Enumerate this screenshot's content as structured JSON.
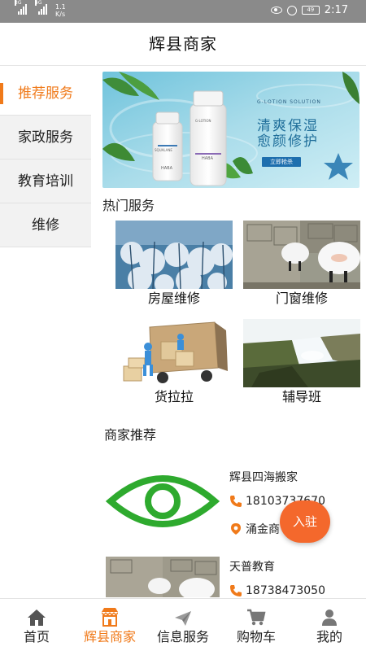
{
  "status_bar": {
    "net_left": "3G",
    "net_right": "4G",
    "speed_value": "1.1",
    "speed_unit": "K/s",
    "battery": "49",
    "time": "2:17"
  },
  "header": {
    "title": "辉县商家"
  },
  "sidebar": {
    "items": [
      {
        "label": "推荐服务",
        "active": true
      },
      {
        "label": "家政服务",
        "active": false
      },
      {
        "label": "教育培训",
        "active": false
      },
      {
        "label": "维修",
        "active": false
      }
    ]
  },
  "banner": {
    "headline_1": "清爽保湿",
    "headline_2": "愈颜修护",
    "subtitle": "G-LOTION  SOLUTION",
    "button": "立即抢杀",
    "bottle_brand": "HABA",
    "bottle_name_1": "SQUALANE",
    "bottle_name_2": "G-LOTION"
  },
  "hot_services": {
    "title": "热门服务",
    "items": [
      {
        "label": "房屋维修"
      },
      {
        "label": "门窗维修"
      },
      {
        "label": "货拉拉"
      },
      {
        "label": "辅导班"
      }
    ]
  },
  "merchants": {
    "title": "商家推荐",
    "items": [
      {
        "name": "辉县四海搬家",
        "phone": "18103737670",
        "address": "涌金商"
      },
      {
        "name": "天普教育",
        "phone": "18738473050"
      }
    ],
    "join_label": "入驻"
  },
  "tabbar": {
    "items": [
      {
        "label": "首页",
        "icon": "home-icon"
      },
      {
        "label": "辉县商家",
        "icon": "store-icon",
        "active": true
      },
      {
        "label": "信息服务",
        "icon": "send-icon"
      },
      {
        "label": "购物车",
        "icon": "cart-icon"
      },
      {
        "label": "我的",
        "icon": "user-icon"
      }
    ]
  },
  "colors": {
    "accent": "#f07a1a",
    "join_button": "#f4682c",
    "eye_logo": "#2eaa2e",
    "phone_icon": "#f07a1a"
  }
}
